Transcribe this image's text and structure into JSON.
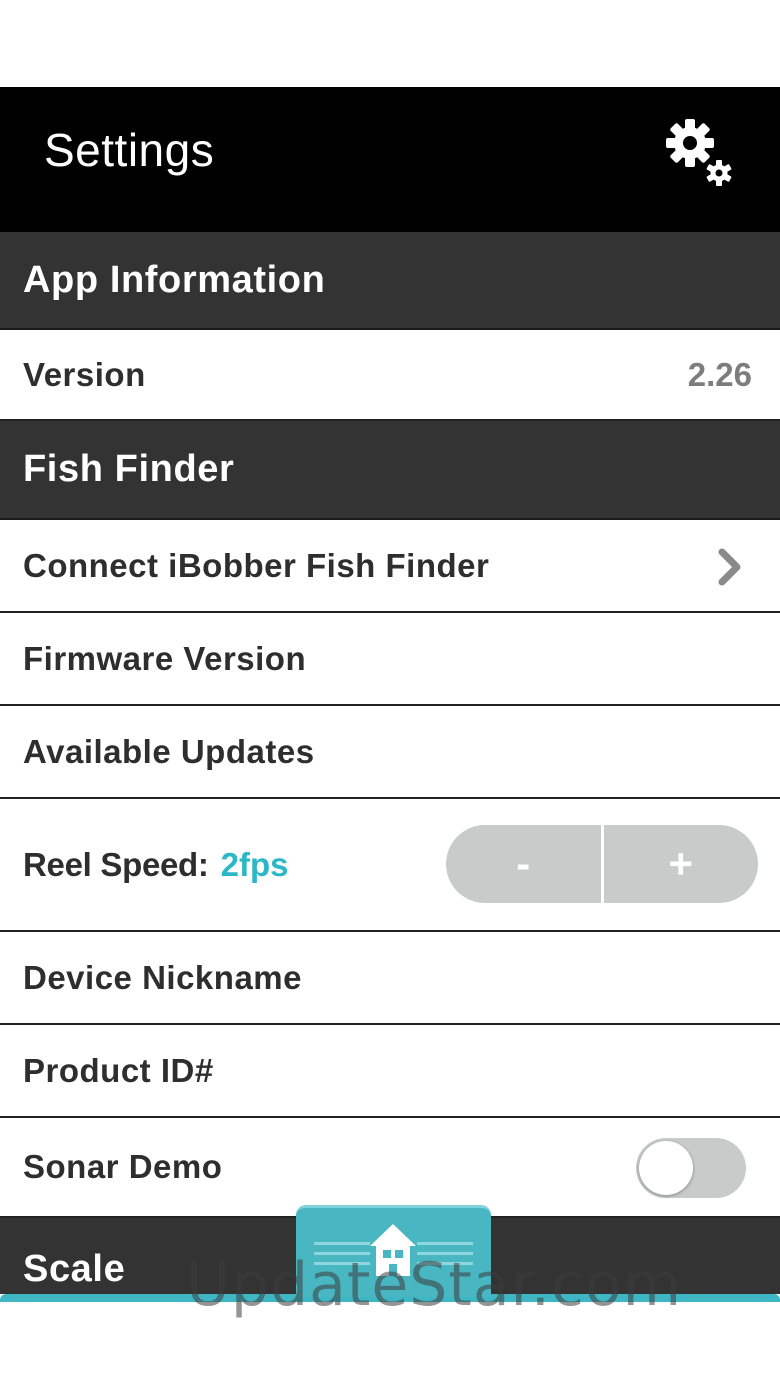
{
  "header": {
    "title": "Settings",
    "icon": "gear-icon"
  },
  "sections": {
    "app_information": "App Information",
    "fish_finder": "Fish Finder",
    "scale": "Scale"
  },
  "rows": {
    "version": {
      "label": "Version",
      "value": "2.26"
    },
    "connect": {
      "label": "Connect iBobber Fish Finder",
      "icon": "chevron-right-icon"
    },
    "firmware": {
      "label": "Firmware Version"
    },
    "updates": {
      "label": "Available Updates"
    },
    "reel_speed": {
      "label": "Reel Speed:",
      "value": "2fps",
      "decrement": "-",
      "increment": "+"
    },
    "nickname": {
      "label": "Device Nickname"
    },
    "product_id": {
      "label": "Product ID#"
    },
    "sonar_demo": {
      "label": "Sonar Demo",
      "toggle_on": false
    }
  },
  "bottom_nav": {
    "home_icon": "home-icon"
  },
  "watermark": "UpdateStar.com",
  "colors": {
    "header_bg": "#000000",
    "section_bg": "#333333",
    "accent": "#2bb8c6",
    "control_grey": "#c9cbcb",
    "nav_teal": "#48b7c2"
  }
}
